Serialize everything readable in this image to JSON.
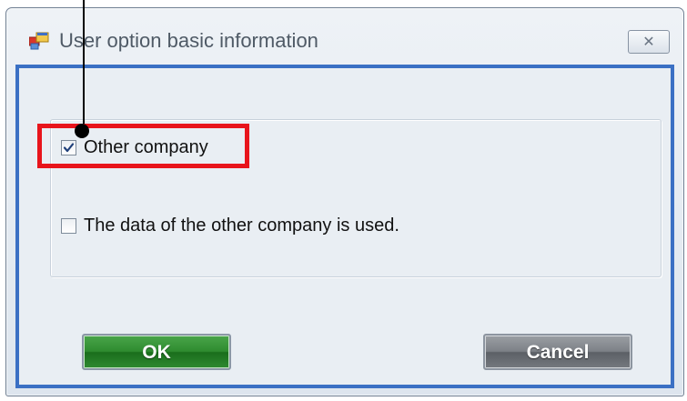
{
  "window": {
    "title": "User option basic information",
    "close_glyph": "✕"
  },
  "options": [
    {
      "label": "Other company",
      "checked": true
    },
    {
      "label": "The data of the other company is used.",
      "checked": false
    }
  ],
  "buttons": {
    "ok_label": "OK",
    "cancel_label": "Cancel"
  },
  "colors": {
    "window_border": "#3b70c4",
    "ok_button": "#2f8c30",
    "cancel_button": "#7d8187",
    "highlight_box": "#e8141b"
  },
  "icons": {
    "title": "application-window-icon",
    "close": "close-icon",
    "check": "checkmark-icon"
  }
}
